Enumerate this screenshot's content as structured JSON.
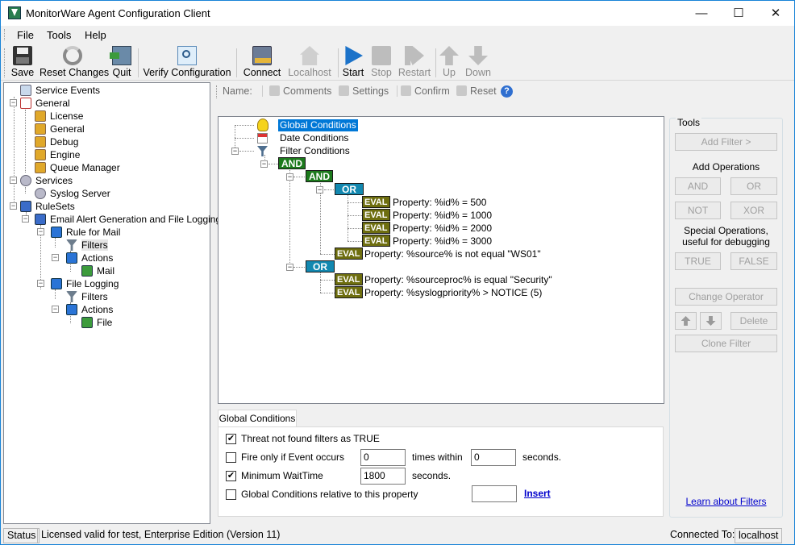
{
  "window": {
    "title": "MonitorWare Agent Configuration Client",
    "minimize": "—",
    "maximize": "☐",
    "close": "✕"
  },
  "menu": [
    "File",
    "Tools",
    "Help"
  ],
  "toolbar": {
    "save": "Save",
    "reset_changes": "Reset Changes",
    "quit": "Quit",
    "verify": "Verify Configuration",
    "connect": "Connect",
    "localhost": "Localhost",
    "start": "Start",
    "stop": "Stop",
    "restart": "Restart",
    "up": "Up",
    "down": "Down"
  },
  "tree": {
    "service_events": "Service Events",
    "general": "General",
    "license": "License",
    "general_child": "General",
    "debug": "Debug",
    "engine": "Engine",
    "queue_manager": "Queue Manager",
    "services": "Services",
    "syslog_server": "Syslog Server",
    "rulesets": "RuleSets",
    "email_alert": "Email Alert Generation and File Logging",
    "rule_for_mail": "Rule for Mail",
    "filters1": "Filters",
    "actions1": "Actions",
    "mail": "Mail",
    "file_logging": "File Logging",
    "filters2": "Filters",
    "actions2": "Actions",
    "file": "File"
  },
  "namebar": {
    "name": "Name:",
    "comments": "Comments",
    "settings": "Settings",
    "confirm": "Confirm",
    "reset": "Reset"
  },
  "conditions": {
    "global": "Global Conditions",
    "date": "Date Conditions",
    "filter": "Filter Conditions",
    "and": "AND",
    "or": "OR",
    "eval": "EVAL",
    "expr1": "Property: %id% = 500",
    "expr2": "Property: %id% = 1000",
    "expr3": "Property: %id% = 2000",
    "expr4": "Property: %id% = 3000",
    "expr5": "Property: %source% is not equal \"WS01\"",
    "expr6": "Property: %sourceproc% is equal \"Security\"",
    "expr7": "Property: %syslogpriority% >  NOTICE (5)"
  },
  "tools": {
    "title": "Tools",
    "add_filter": "Add Filter >",
    "add_operations": "Add Operations",
    "and": "AND",
    "or": "OR",
    "not": "NOT",
    "xor": "XOR",
    "special_ops": "Special Operations,",
    "special_ops2": "useful for debugging",
    "true": "TRUE",
    "false": "FALSE",
    "change_operator": "Change Operator",
    "delete": "Delete",
    "clone_filter": "Clone Filter",
    "learn": "Learn about Filters"
  },
  "global_panel": {
    "tab": "Global Conditions",
    "threat_label": "Threat not found filters as TRUE",
    "threat_checked": "✔",
    "fire_label": "Fire only if Event occurs",
    "fire_count": "0",
    "times_within": "times within",
    "fire_seconds": "0",
    "seconds": "seconds.",
    "min_wait_label": "Minimum WaitTime",
    "min_wait_checked": "✔",
    "min_wait_value": "1800",
    "seconds2": "seconds.",
    "relative_label": "Global Conditions relative to this property",
    "insert": "Insert"
  },
  "status": {
    "label": "Status",
    "license": "Licensed valid for test, Enterprise Edition (Version 11)",
    "connected": "Connected To:",
    "host": "localhost"
  }
}
